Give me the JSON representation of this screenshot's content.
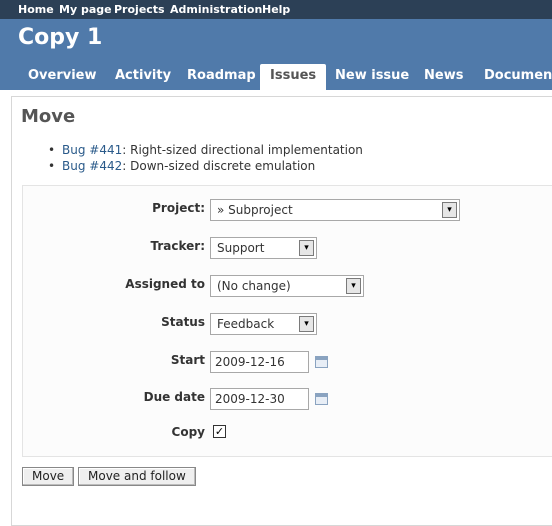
{
  "top_menu": [
    "Home",
    "My page",
    "Projects",
    "Administration",
    "Help"
  ],
  "project": {
    "title": "Copy 1"
  },
  "main_menu": {
    "tabs": [
      "Overview",
      "Activity",
      "Roadmap",
      "Issues",
      "New issue",
      "News",
      "Documents"
    ],
    "selected": "Issues"
  },
  "page": {
    "title": "Move"
  },
  "issues": [
    {
      "bullet": "•",
      "id": "Bug #441",
      "separator": ":",
      "subject": "Right-sized directional implementation"
    },
    {
      "bullet": "•",
      "id": "Bug #442",
      "separator": ":",
      "subject": "Down-sized discrete emulation"
    }
  ],
  "form": {
    "project": {
      "label": "Project:",
      "value": "» Subproject"
    },
    "tracker": {
      "label": "Tracker:",
      "value": "Support"
    },
    "assigned_to": {
      "label": "Assigned to",
      "value": "(No change)"
    },
    "status": {
      "label": "Status",
      "value": "Feedback"
    },
    "start": {
      "label": "Start",
      "value": "2009-12-16"
    },
    "due_date": {
      "label": "Due date",
      "value": "2009-12-30"
    },
    "copy": {
      "label": "Copy",
      "checked": true,
      "mark": "✓"
    }
  },
  "buttons": {
    "move": "Move",
    "move_and_follow": "Move and follow"
  },
  "colors": {
    "top_menu": "#2c4056",
    "header": "#507aaa",
    "link": "#2a5a8a"
  },
  "icons": {
    "select_arrow": "▾",
    "calendar": "calendar-icon"
  }
}
